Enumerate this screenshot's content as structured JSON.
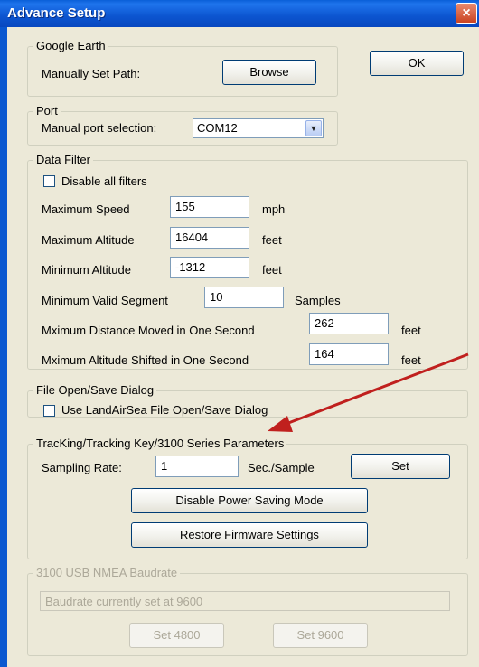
{
  "window": {
    "title": "Advance Setup",
    "close_glyph": "×"
  },
  "google_earth": {
    "legend": "Google Earth",
    "label": "Manually Set Path:",
    "browse_label": "Browse"
  },
  "ok_label": "OK",
  "port": {
    "legend": "Port",
    "label": "Manual port selection:",
    "selected": "COM12",
    "arrow_glyph": "▼"
  },
  "data_filter": {
    "legend": "Data Filter",
    "disable_all_label": "Disable all filters",
    "disable_all_checked": false,
    "max_speed": {
      "label": "Maximum Speed",
      "value": "155",
      "unit": "mph"
    },
    "max_altitude": {
      "label": "Maximum Altitude",
      "value": "16404",
      "unit": "feet"
    },
    "min_altitude": {
      "label": "Minimum Altitude",
      "value": "-1312",
      "unit": "feet"
    },
    "min_segment": {
      "label": "Minimum Valid Segment",
      "value": "10",
      "unit": "Samples"
    },
    "max_distance": {
      "label": "Mximum Distance Moved in One Second",
      "value": "262",
      "unit": "feet"
    },
    "max_alt_shift": {
      "label": "Mximum Altitude Shifted in One Second",
      "value": "164",
      "unit": "feet"
    }
  },
  "file_dialog": {
    "legend": "File Open/Save Dialog",
    "checkbox_label": "Use LandAirSea File Open/Save Dialog",
    "checked": false
  },
  "tracking": {
    "legend": "TracKing/Tracking Key/3100 Series Parameters",
    "sampling_label": "Sampling Rate:",
    "sampling_value": "1",
    "sampling_unit": "Sec./Sample",
    "set_label": "Set",
    "disable_power_label": "Disable Power Saving Mode",
    "restore_firmware_label": "Restore Firmware Settings"
  },
  "nmea": {
    "legend": "3100 USB NMEA Baudrate",
    "status_text": "Baudrate currently set at 9600",
    "set4800_label": "Set 4800",
    "set9600_label": "Set 9600"
  },
  "colors": {
    "titlebar": "#0a5fd8",
    "arrow_annotation": "#c0201e",
    "disabled_text": "#aca899"
  }
}
